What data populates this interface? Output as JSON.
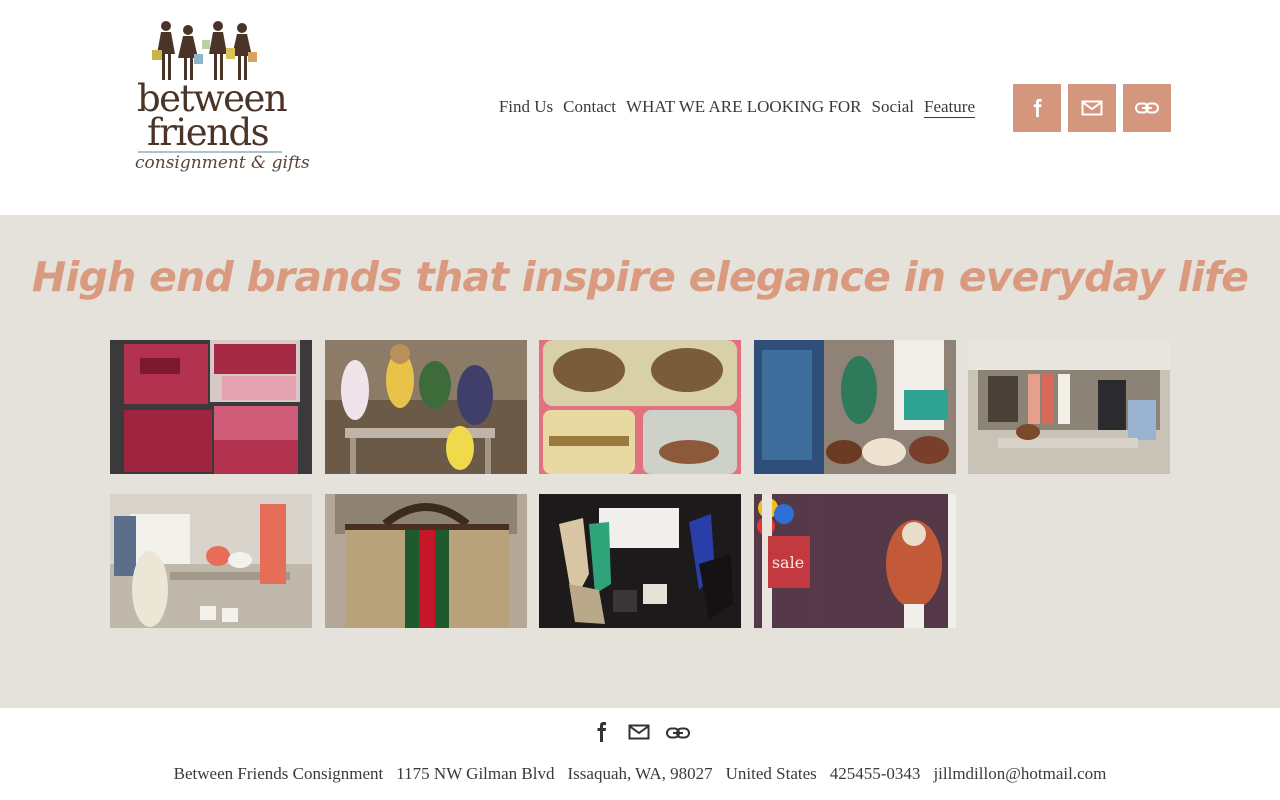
{
  "brand": {
    "name_line1": "between",
    "name_line2": "friends",
    "tagline": "consignment & gifts"
  },
  "nav": {
    "items": [
      {
        "label": "Find Us"
      },
      {
        "label": "Contact"
      },
      {
        "label": "WHAT WE ARE LOOKING FOR"
      },
      {
        "label": "Social"
      },
      {
        "label": "Feature",
        "active": true
      }
    ]
  },
  "social_icons": [
    "facebook-icon",
    "email-icon",
    "link-icon"
  ],
  "main": {
    "headline": "High end brands that inspire elegance in everyday life",
    "gallery_count": 9
  },
  "footer": {
    "business_name": "Between Friends Consignment",
    "street": "1175 NW Gilman Blvd",
    "city_state_zip": "Issaquah, WA, 98027",
    "country": "United States",
    "phone": "425455-0343",
    "email": "jillmdillon@hotmail.com"
  },
  "colors": {
    "accent": "#d4977d",
    "headline": "#d99a80",
    "band_background": "#e5e2dc",
    "logo_brown": "#4a3427"
  }
}
